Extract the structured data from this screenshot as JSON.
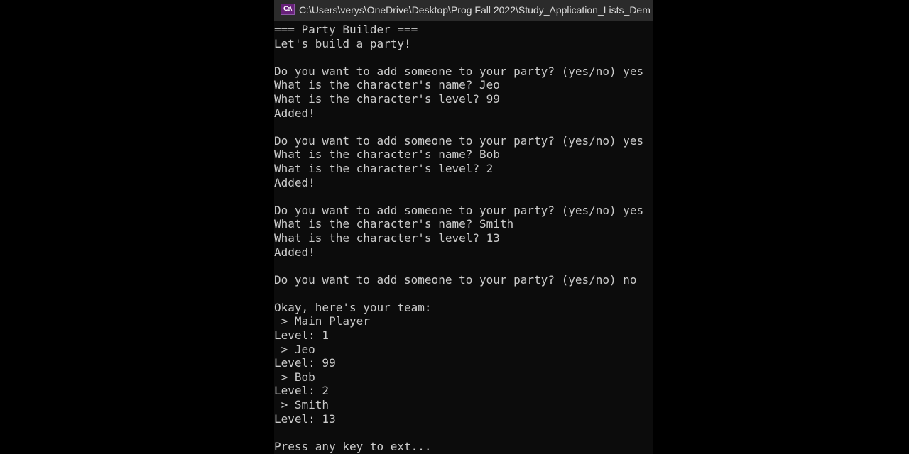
{
  "window": {
    "icon_label": "C:\\",
    "title": "C:\\Users\\verys\\OneDrive\\Desktop\\Prog Fall 2022\\Study_Application_Lists_Dem"
  },
  "console": {
    "lines": [
      "=== Party Builder ===",
      "Let's build a party!",
      "",
      "Do you want to add someone to your party? (yes/no) yes",
      "What is the character's name? Jeo",
      "What is the character's level? 99",
      "Added!",
      "",
      "Do you want to add someone to your party? (yes/no) yes",
      "What is the character's name? Bob",
      "What is the character's level? 2",
      "Added!",
      "",
      "Do you want to add someone to your party? (yes/no) yes",
      "What is the character's name? Smith",
      "What is the character's level? 13",
      "Added!",
      "",
      "Do you want to add someone to your party? (yes/no) no",
      "",
      "Okay, here's your team:",
      " > Main Player",
      "Level: 1",
      " > Jeo",
      "Level: 99",
      " > Bob",
      "Level: 2",
      " > Smith",
      "Level: 13",
      "",
      "Press any key to ext..."
    ]
  }
}
